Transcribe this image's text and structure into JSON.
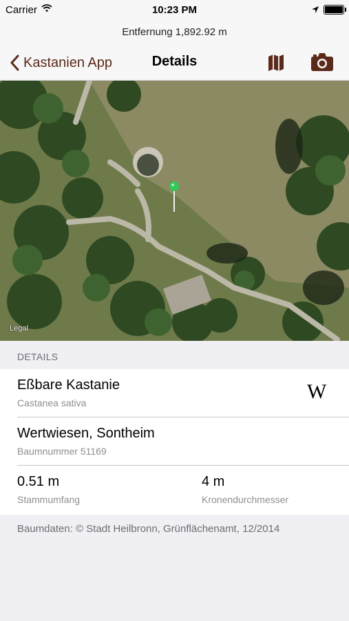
{
  "status_bar": {
    "carrier": "Carrier",
    "time": "10:23 PM"
  },
  "distance_label": "Entfernung 1,892.92 m",
  "nav": {
    "back_label": "Kastanien App",
    "title": "Details"
  },
  "map": {
    "legal_label": "Legal"
  },
  "section_header": "DETAILS",
  "species": {
    "common_name": "Eßbare Kastanie",
    "latin_name": "Castanea sativa",
    "wiki_label": "W"
  },
  "location": {
    "name": "Wertwiesen, Sontheim",
    "tree_number": "Baumnummer 51169"
  },
  "measurements": {
    "trunk_value": "0.51 m",
    "trunk_label": "Stammumfang",
    "crown_value": "4 m",
    "crown_label": "Kronendurchmesser"
  },
  "footer_text": "Baumdaten: © Stadt Heilbronn, Grünflächenamt, 12/2014",
  "colors": {
    "accent": "#5b2a1b",
    "pin": "#34c759",
    "background": "#efeff4"
  }
}
